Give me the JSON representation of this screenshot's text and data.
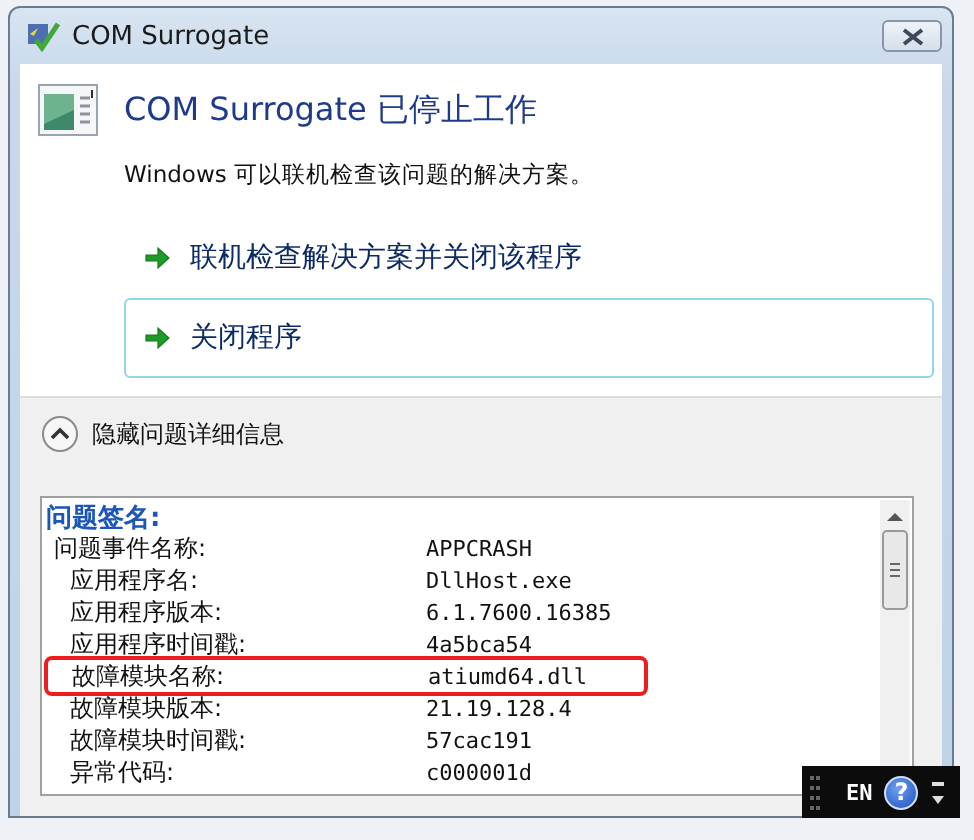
{
  "window": {
    "title": "COM Surrogate"
  },
  "header": {
    "title": "COM Surrogate 已停止工作",
    "message": "Windows 可以联机检查该问题的解决方案。"
  },
  "commands": [
    {
      "label": "联机检查解决方案并关闭该程序",
      "focused": false
    },
    {
      "label": "关闭程序",
      "focused": true
    }
  ],
  "details_toggle": {
    "label": "隐藏问题详细信息",
    "expanded": true
  },
  "details": {
    "heading": "问题签名:",
    "rows": [
      {
        "kind": "event",
        "label": "问题事件名称:",
        "value": "APPCRASH",
        "highlighted": false
      },
      {
        "kind": "detail",
        "label": "应用程序名:",
        "value": "DllHost.exe",
        "highlighted": false
      },
      {
        "kind": "detail",
        "label": "应用程序版本:",
        "value": "6.1.7600.16385",
        "highlighted": false
      },
      {
        "kind": "detail",
        "label": "应用程序时间戳:",
        "value": "4a5bca54",
        "highlighted": false
      },
      {
        "kind": "detail",
        "label": "故障模块名称:",
        "value": "atiumd64.dll",
        "highlighted": true
      },
      {
        "kind": "detail",
        "label": "故障模块版本:",
        "value": "21.19.128.4",
        "highlighted": false
      },
      {
        "kind": "detail",
        "label": "故障模块时间戳:",
        "value": "57cac191",
        "highlighted": false
      },
      {
        "kind": "detail",
        "label": "异常代码:",
        "value": "c000001d",
        "highlighted": false
      }
    ]
  },
  "language_bar": {
    "language": "EN",
    "help": "?"
  }
}
